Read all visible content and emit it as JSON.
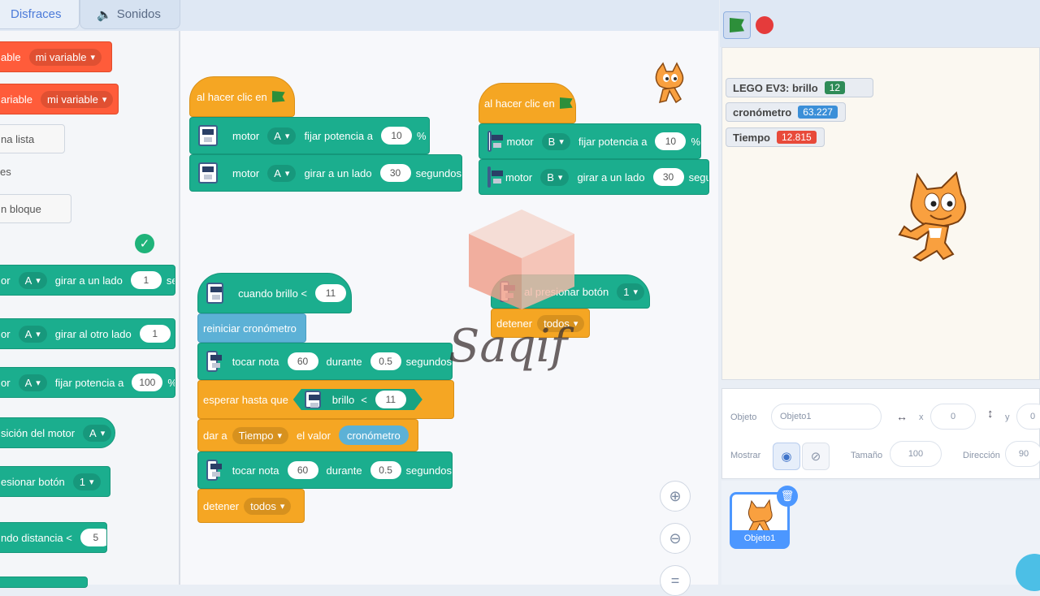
{
  "tabs": {
    "costumes": "Disfraces",
    "sounds": "Sonidos"
  },
  "palette": {
    "var_block_1": {
      "prefix": "able",
      "dropdown": "mi variable"
    },
    "var_block_2": {
      "prefix": "ariable",
      "dropdown": "mi variable"
    },
    "make_list": "na lista",
    "section_my_blocks": "es",
    "make_block": "n bloque",
    "turn_one_way": {
      "prefix": "or",
      "port": "A",
      "text": "girar a un lado",
      "value": "1",
      "suffix": "se"
    },
    "turn_other_way": {
      "prefix": "or",
      "port": "A",
      "text": "girar al otro lado",
      "value": "1",
      "suffix": "s"
    },
    "set_power": {
      "prefix": "or",
      "port": "A",
      "text": "fijar potencia a",
      "value": "100",
      "suffix": "%"
    },
    "motor_position": {
      "text": "sición del motor",
      "port": "A"
    },
    "button_pressed": {
      "text": "esionar botón",
      "value": "1"
    },
    "distance": {
      "text": "ndo distancia <",
      "value": "5"
    }
  },
  "script1": {
    "hat": "al hacer clic en",
    "b1": {
      "motor": "motor",
      "port": "A",
      "text": "fijar potencia a",
      "value": "10",
      "unit": "%"
    },
    "b2": {
      "motor": "motor",
      "port": "A",
      "text": "girar a un lado",
      "value": "30",
      "unit": "segundos"
    }
  },
  "script2": {
    "hat": "al hacer clic en",
    "b1": {
      "motor": "motor",
      "port": "B",
      "text": "fijar potencia a",
      "value": "10",
      "unit": "%"
    },
    "b2": {
      "motor": "motor",
      "port": "B",
      "text": "girar a un lado",
      "value": "30",
      "unit": "segu"
    }
  },
  "script3": {
    "hat": {
      "text": "cuando brillo <",
      "value": "11"
    },
    "reset": "reiniciar cronómetro",
    "note1": {
      "text": "tocar nota",
      "note": "60",
      "during": "durante",
      "beats": "0.5",
      "unit": "segundos"
    },
    "wait": {
      "text": "esperar hasta que",
      "sensor": "brillo",
      "op": "<",
      "value": "11"
    },
    "set": {
      "text": "dar a",
      "var": "Tiempo",
      "mid": "el valor",
      "reporter": "cronómetro"
    },
    "note2": {
      "text": "tocar nota",
      "note": "60",
      "during": "durante",
      "beats": "0.5",
      "unit": "segundos"
    },
    "stop": {
      "text": "detener",
      "option": "todos"
    }
  },
  "script4": {
    "hat": {
      "text": "al presionar botón",
      "value": "1"
    },
    "stop": {
      "text": "detener",
      "option": "todos"
    }
  },
  "watermark": "Saqif",
  "monitors": [
    {
      "label": "LEGO EV3: brillo",
      "value": "12",
      "color": "#2e8b57"
    },
    {
      "label": "cronómetro",
      "value": "63.227",
      "color": "#3b8fd8"
    },
    {
      "label": "Tiempo",
      "value": "12.815",
      "color": "#e84a3a"
    }
  ],
  "sprite_info": {
    "object_label": "Objeto",
    "object_name": "Objeto1",
    "x_label": "x",
    "x_value": "0",
    "y_label": "y",
    "y_value": "0",
    "show_label": "Mostrar",
    "size_label": "Tamaño",
    "size_value": "100",
    "direction_label": "Dirección",
    "direction_value": "90"
  },
  "sprite_thumb": "Objeto1"
}
